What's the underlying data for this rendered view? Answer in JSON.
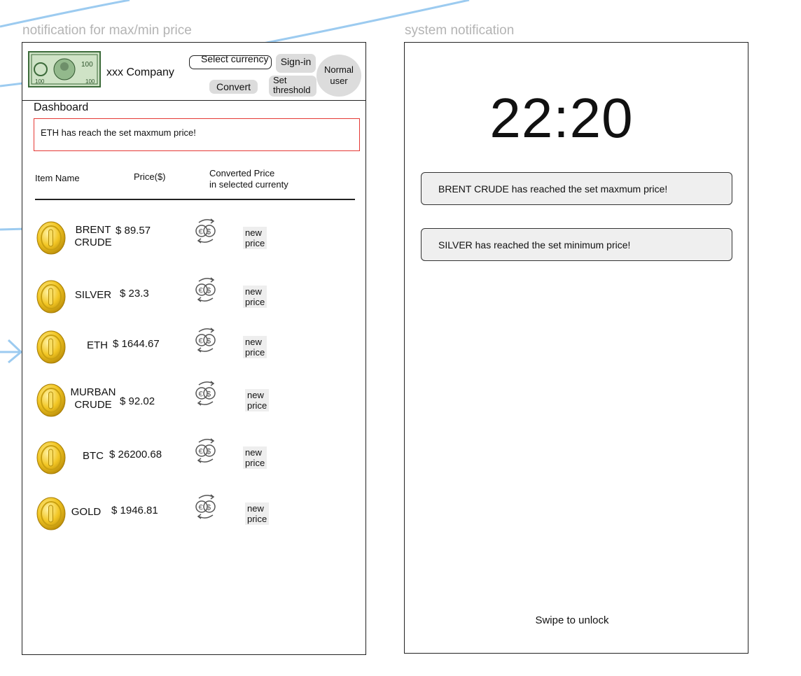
{
  "left_frame": {
    "label": "notification for max/min price",
    "header": {
      "company_name": "xxx Company",
      "select_currency_label": "Select currency",
      "sign_in_label": "Sign-in",
      "convert_label": "Convert",
      "set_threshold_label": "Set threshold",
      "user_role_label": "Normal user",
      "logo_icon": "dollar-bill-logo"
    },
    "dashboard_title": "Dashboard",
    "alert_message": "ETH has reach the set maxmum price!",
    "alert_border_color": "#e53935",
    "table": {
      "col_item": "Item Name",
      "col_price": "Price($)",
      "col_converted_line1": "Converted Price",
      "col_converted_line2": "in selected currenty",
      "rows": [
        {
          "name_line1": "BRENT",
          "name_line2": "CRUDE",
          "price": "$ 89.57",
          "converted": "new price",
          "icon": "gold-coin-icon"
        },
        {
          "name_line1": "SILVER",
          "name_line2": "",
          "price": "$ 23.3",
          "converted": "new price",
          "icon": "gold-coin-icon"
        },
        {
          "name_line1": "ETH",
          "name_line2": "",
          "price": "$ 1644.67",
          "converted": "new price",
          "icon": "gold-coin-icon"
        },
        {
          "name_line1": "MURBAN",
          "name_line2": "CRUDE",
          "price": "$ 92.02",
          "converted": "new price",
          "icon": "gold-coin-icon"
        },
        {
          "name_line1": "BTC",
          "name_line2": "",
          "price": "$ 26200.68",
          "converted": "new price",
          "icon": "gold-coin-icon"
        },
        {
          "name_line1": "GOLD",
          "name_line2": "",
          "price": "$ 1946.81",
          "converted": "new price",
          "icon": "gold-coin-icon"
        }
      ]
    }
  },
  "right_frame": {
    "label": "system notification",
    "clock": "22:20",
    "notifications": [
      {
        "text": "BRENT CRUDE has reached the set maxmum price!"
      },
      {
        "text": "SILVER has reached the set minimum price!"
      }
    ],
    "swipe_label": "Swipe to unlock"
  },
  "colors": {
    "connector_line": "#9ccbf0",
    "button_bg": "#dcdcdc",
    "notification_bg": "#efefef"
  }
}
